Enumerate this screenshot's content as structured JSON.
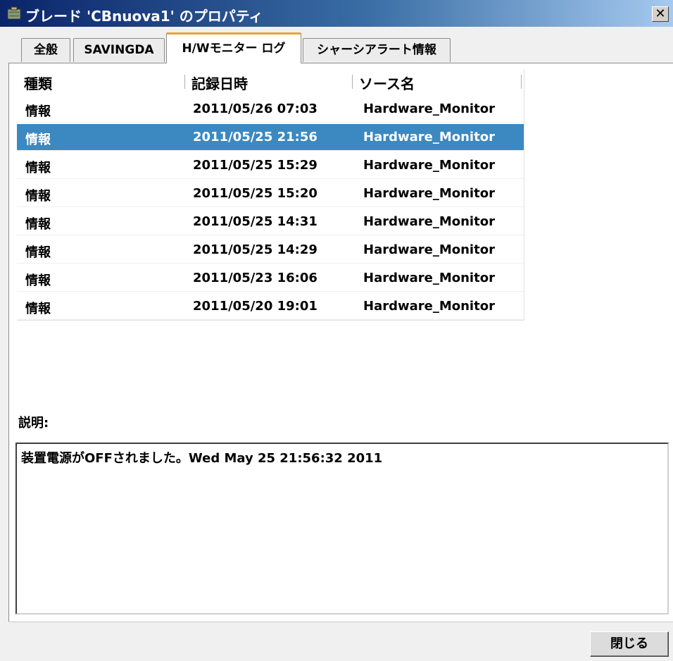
{
  "window": {
    "title": "ブレード 'CBnuova1' のプロパティ",
    "close_glyph": "✕"
  },
  "tabs": [
    {
      "label": "全般"
    },
    {
      "label": "SAVINGDA"
    },
    {
      "label": "H/Wモニター ログ",
      "active": true
    },
    {
      "label": "シャーシアラート情報"
    }
  ],
  "log_table": {
    "columns": [
      "種類",
      "記録日時",
      "ソース名"
    ],
    "rows": [
      {
        "type": "情報",
        "datetime": "2011/05/26 07:03",
        "source": "Hardware_Monitor",
        "selected": false
      },
      {
        "type": "情報",
        "datetime": "2011/05/25 21:56",
        "source": "Hardware_Monitor",
        "selected": true
      },
      {
        "type": "情報",
        "datetime": "2011/05/25 15:29",
        "source": "Hardware_Monitor",
        "selected": false
      },
      {
        "type": "情報",
        "datetime": "2011/05/25 15:20",
        "source": "Hardware_Monitor",
        "selected": false
      },
      {
        "type": "情報",
        "datetime": "2011/05/25 14:31",
        "source": "Hardware_Monitor",
        "selected": false
      },
      {
        "type": "情報",
        "datetime": "2011/05/25 14:29",
        "source": "Hardware_Monitor",
        "selected": false
      },
      {
        "type": "情報",
        "datetime": "2011/05/23 16:06",
        "source": "Hardware_Monitor",
        "selected": false
      },
      {
        "type": "情報",
        "datetime": "2011/05/20 19:01",
        "source": "Hardware_Monitor",
        "selected": false
      }
    ]
  },
  "description": {
    "label": "説明:",
    "text": "装置電源がOFFされました。Wed May 25 21:56:32 2011"
  },
  "footer": {
    "close_label": "閉じる"
  },
  "colors": {
    "selection": "#3c88c0",
    "active_tab_accent": "#e9a23b",
    "titlebar": "#0a246a"
  },
  "icons": {
    "title_icon": "blade-server-icon"
  }
}
